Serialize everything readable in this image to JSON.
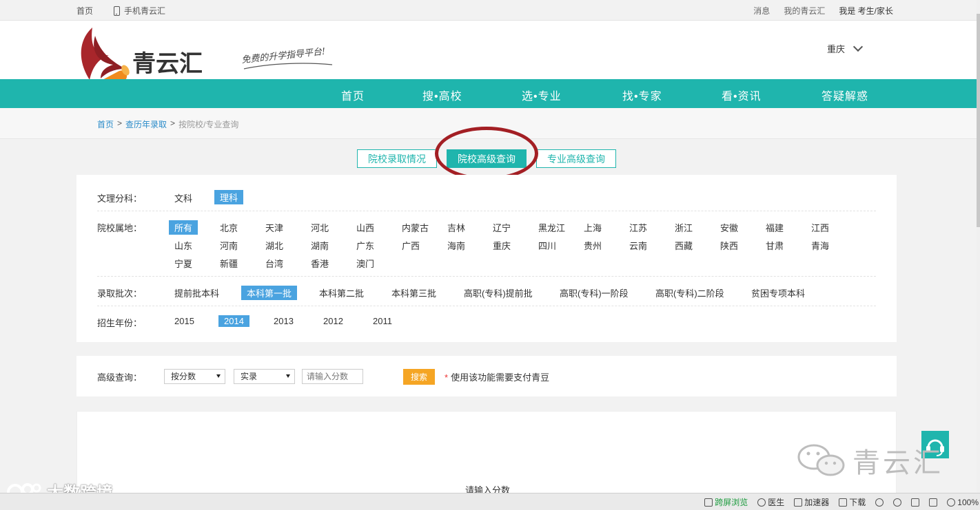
{
  "topbar": {
    "home": "首页",
    "mobile": "手机青云汇",
    "messages": "消息",
    "my": "我的青云汇",
    "identity": "我是 考生/家长"
  },
  "header": {
    "brand": "青云汇",
    "slogan": "免费的升学指导平台!",
    "city": "重庆"
  },
  "nav": [
    "首页",
    "搜•高校",
    "选•专业",
    "找•专家",
    "看•资讯",
    "答疑解惑"
  ],
  "breadcrumb": {
    "home": "首页",
    "sep": ">",
    "history": "查历年录取",
    "current": "按院校/专业查询"
  },
  "tabs": [
    "院校录取情况",
    "院校高级查询",
    "专业高级查询"
  ],
  "filters": {
    "subject": {
      "label": "文理分科：",
      "options": [
        "文科",
        "理科"
      ],
      "selected": "理科"
    },
    "region": {
      "label": "院校属地：",
      "options": [
        "所有",
        "北京",
        "天津",
        "河北",
        "山西",
        "内蒙古",
        "吉林",
        "辽宁",
        "黑龙江",
        "上海",
        "江苏",
        "浙江",
        "安徽",
        "福建",
        "江西",
        "山东",
        "河南",
        "湖北",
        "湖南",
        "广东",
        "广西",
        "海南",
        "重庆",
        "四川",
        "贵州",
        "云南",
        "西藏",
        "陕西",
        "甘肃",
        "青海",
        "宁夏",
        "新疆",
        "台湾",
        "香港",
        "澳门"
      ],
      "selected": "所有"
    },
    "batch": {
      "label": "录取批次：",
      "options": [
        "提前批本科",
        "本科第一批",
        "本科第二批",
        "本科第三批",
        "高职(专科)提前批",
        "高职(专科)一阶段",
        "高职(专科)二阶段",
        "贫困专项本科"
      ],
      "selected": "本科第一批"
    },
    "year": {
      "label": "招生年份：",
      "options": [
        "2015",
        "2014",
        "2013",
        "2012",
        "2011"
      ],
      "selected": "2014"
    }
  },
  "advanced": {
    "label": "高级查询：",
    "mode": "按分数",
    "type": "实录",
    "placeholder": "请输入分数",
    "search": "搜索",
    "note_star": "*",
    "note": "使用该功能需要支付青豆"
  },
  "result": {
    "message": "请输入分数"
  },
  "watermark": {
    "right": "青云汇",
    "left": "大数跨境"
  },
  "statusbar": {
    "cross_screen": "跨屏浏览",
    "doctor": "医生",
    "accelerator": "加速器",
    "download": "下载",
    "zoom": "100%"
  },
  "colors": {
    "teal": "#1fb5ad",
    "blue": "#4aa3e0",
    "orange": "#f5a524",
    "red_ring": "#a31f24"
  }
}
